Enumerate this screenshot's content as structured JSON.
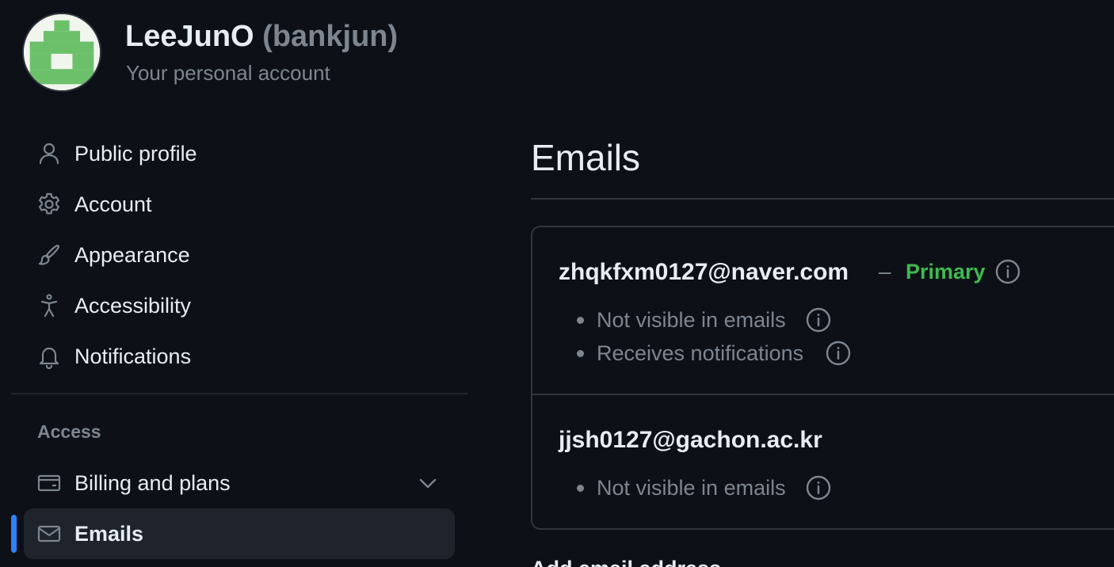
{
  "header": {
    "display_name": "LeeJunO",
    "username": "(bankjun)",
    "subtitle": "Your personal account"
  },
  "sidebar": {
    "items": [
      {
        "label": "Public profile",
        "icon": "person-icon"
      },
      {
        "label": "Account",
        "icon": "gear-icon"
      },
      {
        "label": "Appearance",
        "icon": "paintbrush-icon"
      },
      {
        "label": "Accessibility",
        "icon": "accessibility-icon"
      },
      {
        "label": "Notifications",
        "icon": "bell-icon"
      }
    ],
    "section_access": {
      "heading": "Access",
      "items": [
        {
          "label": "Billing and plans",
          "icon": "credit-card-icon",
          "expandable": true
        },
        {
          "label": "Emails",
          "icon": "mail-icon",
          "active": true
        }
      ]
    }
  },
  "main": {
    "title": "Emails",
    "emails": [
      {
        "address": "zhqkfxm0127@naver.com",
        "separator": "–",
        "badge": "Primary",
        "details": [
          "Not visible in emails",
          "Receives notifications"
        ]
      },
      {
        "address": "jjsh0127@gachon.ac.kr",
        "details": [
          "Not visible in emails"
        ]
      }
    ],
    "add_email_heading": "Add email address"
  },
  "colors": {
    "background": "#0d1117",
    "accent": "#2f81f7",
    "primary_badge": "#3fb950",
    "muted_text": "#7d8590"
  }
}
